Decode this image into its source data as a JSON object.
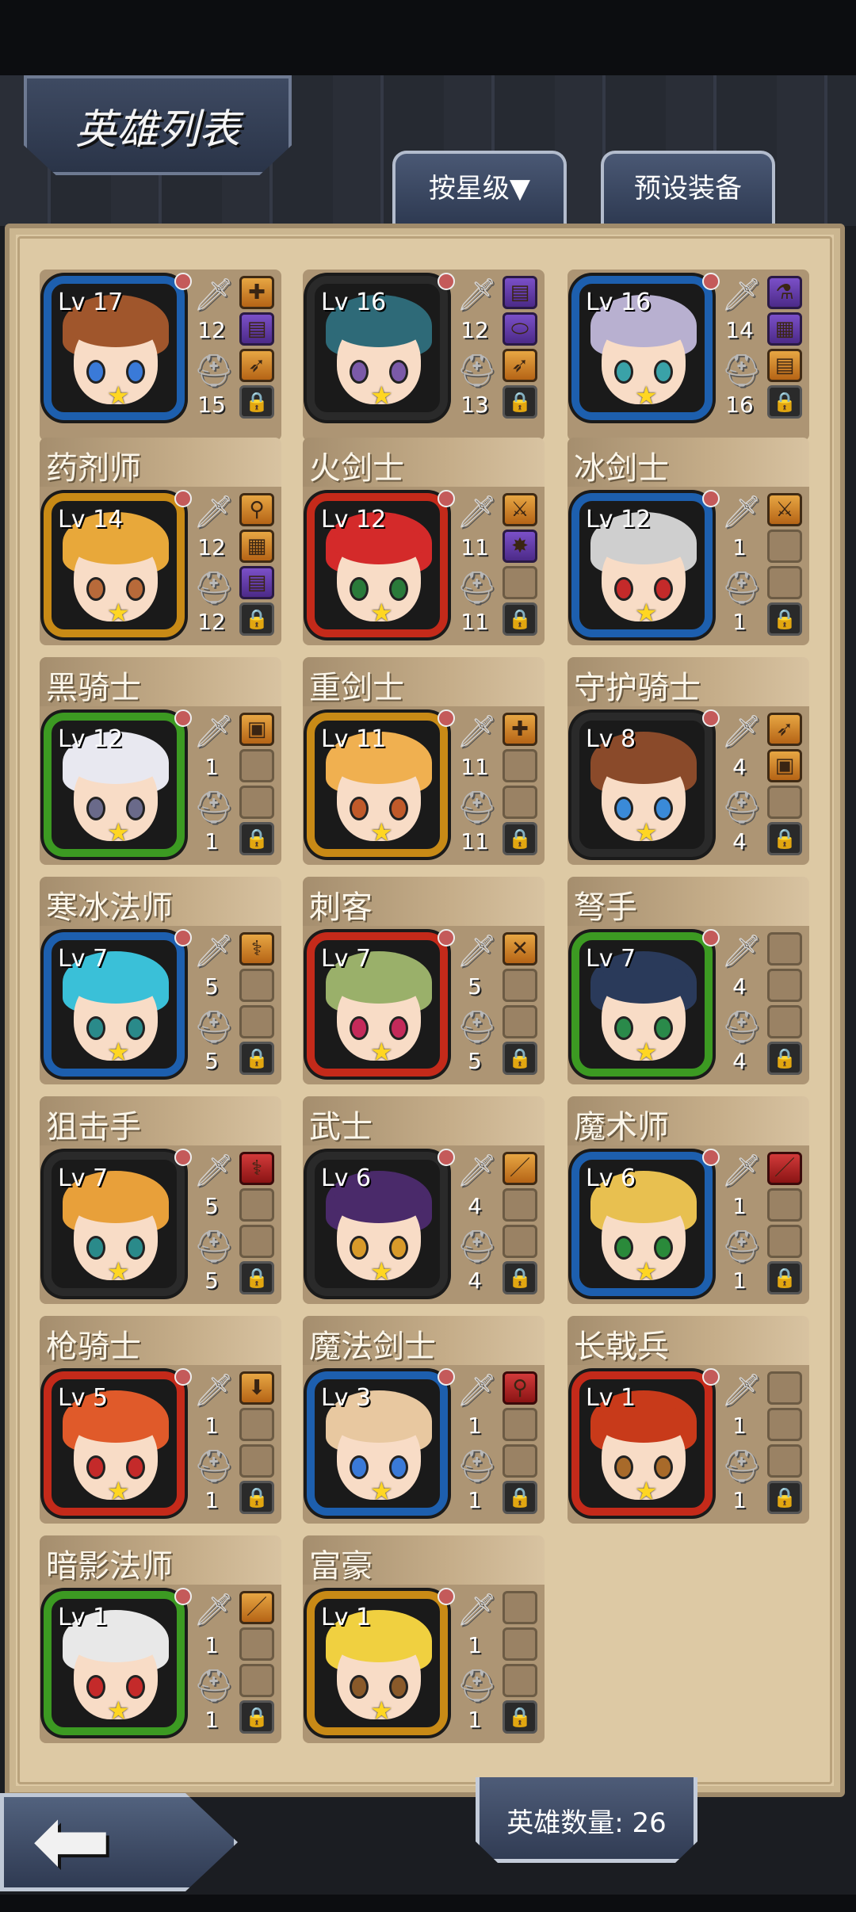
{
  "header": {
    "title": "英雄列表"
  },
  "tabs": [
    {
      "label": "按星级▼"
    },
    {
      "label": "预设装备"
    }
  ],
  "footer": {
    "count_text": "英雄数量: 26"
  },
  "colors": {
    "blue_frame": "#1d5fae",
    "gold_frame": "#c88a16",
    "red_frame": "#c42a1a",
    "green_frame": "#3c9a22",
    "dark_frame": "#2a2a2a"
  },
  "heroes": [
    {
      "name": "",
      "lv": "Lv 17",
      "atk": "12",
      "def": "15",
      "frame": "blue",
      "hair": "#a0562c",
      "eye": "#3a7ad8",
      "slots": [
        "item:✚",
        "purple:▤",
        "item:➶",
        "lock"
      ]
    },
    {
      "name": "",
      "lv": "Lv 16",
      "atk": "12",
      "def": "13",
      "frame": "dark",
      "hair": "#2e6a78",
      "eye": "#7b5aa8",
      "slots": [
        "purple:▤",
        "purple:⬭",
        "item:➶",
        "lock"
      ]
    },
    {
      "name": "",
      "lv": "Lv 16",
      "atk": "14",
      "def": "16",
      "frame": "blue",
      "hair": "#b8b0d0",
      "eye": "#3aa2a8",
      "slots": [
        "purple:⚗",
        "purple:▦",
        "item:▤",
        "lock"
      ]
    },
    {
      "name": "药剂师",
      "lv": "Lv 14",
      "atk": "12",
      "def": "12",
      "frame": "gold",
      "hair": "#e8a83a",
      "eye": "#b86a3a",
      "slots": [
        "item:⚲",
        "item:▦",
        "purple:▤",
        "lock"
      ]
    },
    {
      "name": "火剑士",
      "lv": "Lv 12",
      "atk": "11",
      "def": "11",
      "frame": "red",
      "hair": "#d42a2a",
      "eye": "#2a7a3a",
      "slots": [
        "item:⚔",
        "purple:✸",
        "empty",
        "lock"
      ]
    },
    {
      "name": "冰剑士",
      "lv": "Lv 12",
      "atk": "1",
      "def": "1",
      "frame": "blue",
      "hair": "#cfcfcf",
      "eye": "#c42a2a",
      "slots": [
        "item:⚔",
        "empty",
        "empty",
        "lock"
      ]
    },
    {
      "name": "黑骑士",
      "lv": "Lv 12",
      "atk": "1",
      "def": "1",
      "frame": "green",
      "hair": "#e8e8f0",
      "eye": "#6a6a8a",
      "slots": [
        "item:▣",
        "empty",
        "empty",
        "lock"
      ]
    },
    {
      "name": "重剑士",
      "lv": "Lv 11",
      "atk": "11",
      "def": "11",
      "frame": "gold",
      "hair": "#f0b050",
      "eye": "#c05a2a",
      "slots": [
        "item:✚",
        "empty",
        "empty",
        "lock"
      ]
    },
    {
      "name": "守护骑士",
      "lv": "Lv 8",
      "atk": "4",
      "def": "4",
      "frame": "dark",
      "hair": "#8a4a2a",
      "eye": "#3a8ad8",
      "slots": [
        "item:➶",
        "item:▣",
        "empty",
        "lock"
      ]
    },
    {
      "name": "寒冰法师",
      "lv": "Lv 7",
      "atk": "5",
      "def": "5",
      "frame": "blue",
      "hair": "#3ac0d8",
      "eye": "#2a8a8a",
      "slots": [
        "item:⚕",
        "empty",
        "empty",
        "lock"
      ]
    },
    {
      "name": "刺客",
      "lv": "Lv 7",
      "atk": "5",
      "def": "5",
      "frame": "red",
      "hair": "#9ab06a",
      "eye": "#c42a5a",
      "slots": [
        "item:✕",
        "empty",
        "empty",
        "lock"
      ]
    },
    {
      "name": "弩手",
      "lv": "Lv 7",
      "atk": "4",
      "def": "4",
      "frame": "green",
      "hair": "#2a3a5a",
      "eye": "#2a8a4a",
      "slots": [
        "empty",
        "empty",
        "empty",
        "lock"
      ]
    },
    {
      "name": "狙击手",
      "lv": "Lv 7",
      "atk": "5",
      "def": "5",
      "frame": "dark",
      "hair": "#e8a03a",
      "eye": "#2a8a8a",
      "slots": [
        "red:⚕",
        "empty",
        "empty",
        "lock"
      ]
    },
    {
      "name": "武士",
      "lv": "Lv 6",
      "atk": "4",
      "def": "4",
      "frame": "dark",
      "hair": "#4a2a6a",
      "eye": "#d89a2a",
      "slots": [
        "item:／",
        "empty",
        "empty",
        "lock"
      ]
    },
    {
      "name": "魔术师",
      "lv": "Lv 6",
      "atk": "1",
      "def": "1",
      "frame": "blue",
      "hair": "#e8c050",
      "eye": "#2a8a3a",
      "slots": [
        "red:／",
        "empty",
        "empty",
        "lock"
      ]
    },
    {
      "name": "枪骑士",
      "lv": "Lv 5",
      "atk": "1",
      "def": "1",
      "frame": "red",
      "hair": "#e05a2a",
      "eye": "#c42a2a",
      "slots": [
        "item:⬇",
        "empty",
        "empty",
        "lock"
      ]
    },
    {
      "name": "魔法剑士",
      "lv": "Lv 3",
      "atk": "1",
      "def": "1",
      "frame": "blue",
      "hair": "#e8c8a0",
      "eye": "#3a7ad8",
      "slots": [
        "red:⚲",
        "empty",
        "empty",
        "lock"
      ]
    },
    {
      "name": "长戟兵",
      "lv": "Lv 1",
      "atk": "1",
      "def": "1",
      "frame": "red",
      "hair": "#c83a1a",
      "eye": "#a86a2a",
      "slots": [
        "empty",
        "empty",
        "empty",
        "lock"
      ]
    },
    {
      "name": "暗影法师",
      "lv": "Lv 1",
      "atk": "1",
      "def": "1",
      "frame": "green",
      "hair": "#e8e8e8",
      "eye": "#c42a2a",
      "slots": [
        "item:／",
        "empty",
        "empty",
        "lock"
      ]
    },
    {
      "name": "富豪",
      "lv": "Lv 1",
      "atk": "1",
      "def": "1",
      "frame": "gold",
      "hair": "#f0d040",
      "eye": "#8a5a2a",
      "slots": [
        "empty",
        "empty",
        "empty",
        "lock"
      ]
    }
  ]
}
